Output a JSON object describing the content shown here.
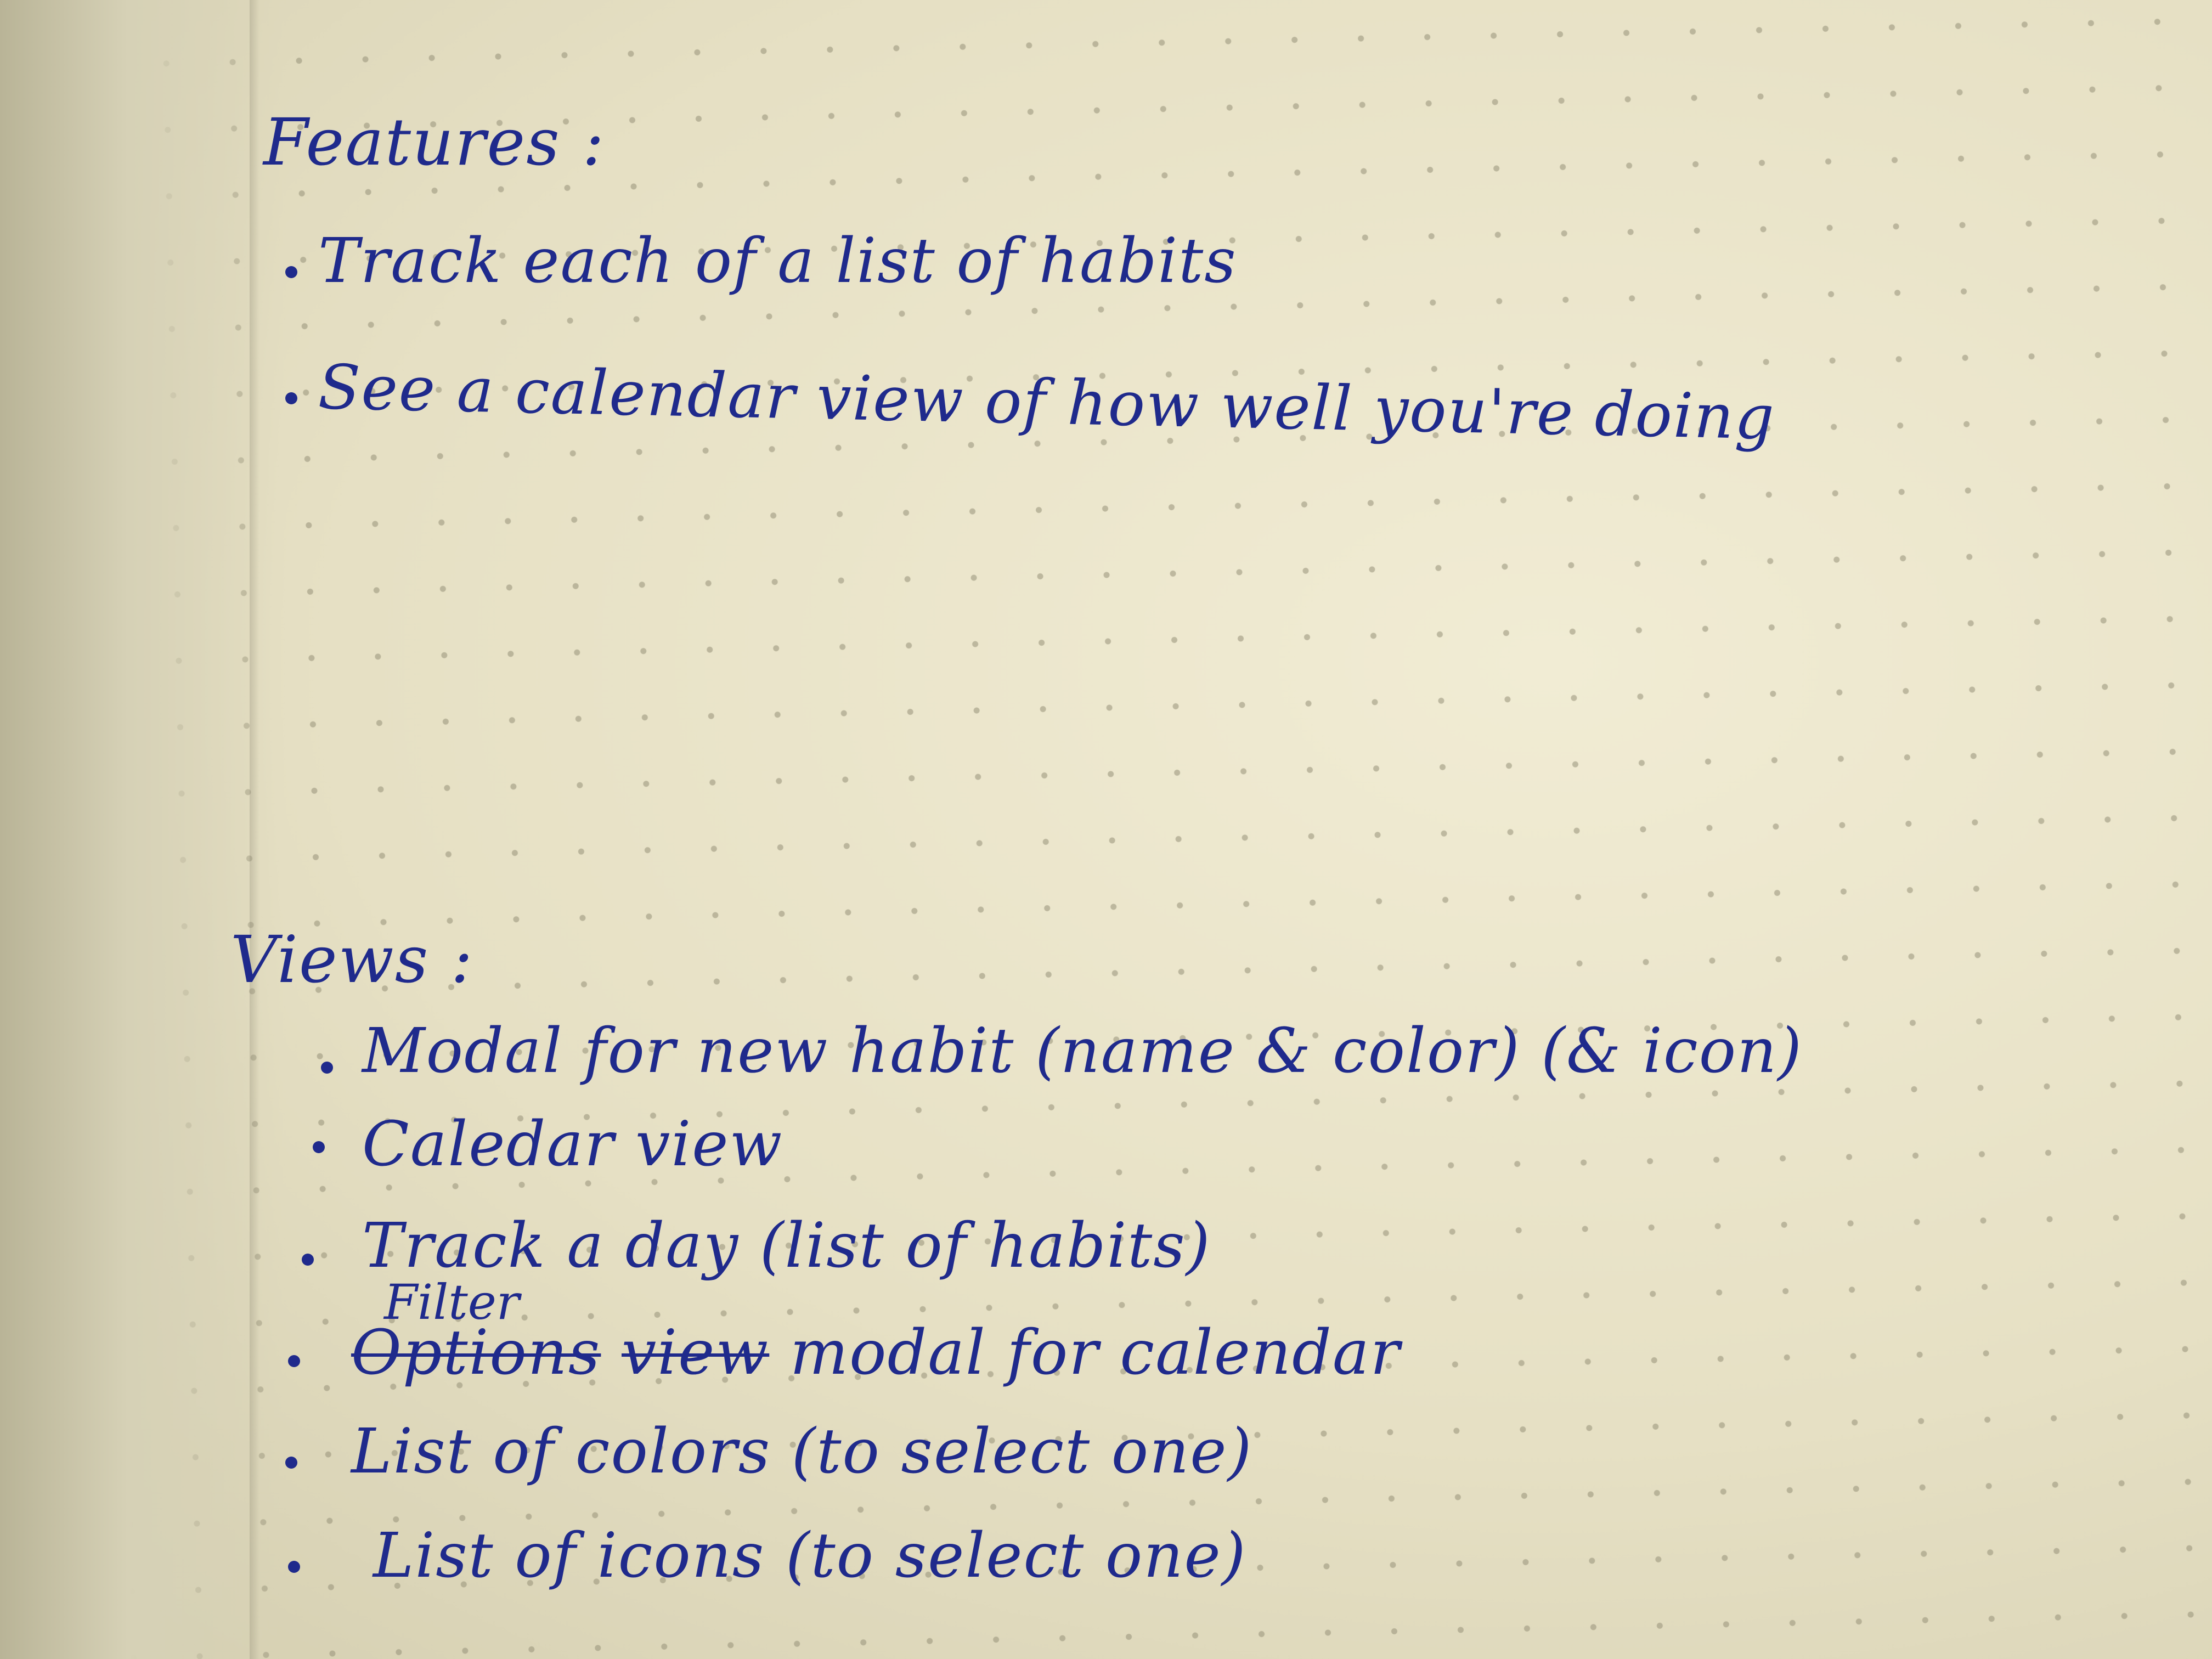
{
  "notebook": {
    "features": {
      "heading": "Features :",
      "items": [
        "Track each of a list of habits",
        "See a calendar view of how well you're doing"
      ]
    },
    "views": {
      "heading": "Views :",
      "items": [
        "Modal for new habit (name & color) (& icon)",
        "Caledar view",
        "Track a day (list of habits)",
        "List of colors (to select one)",
        "List of icons (to select one)"
      ],
      "filter_item": {
        "struck_word_1": "Options",
        "struck_word_2": "view",
        "inserted_word": "Filter",
        "rest": "modal for calendar"
      }
    },
    "ink_color": "#1f2a8c",
    "paper_color": "#ece6cc"
  }
}
